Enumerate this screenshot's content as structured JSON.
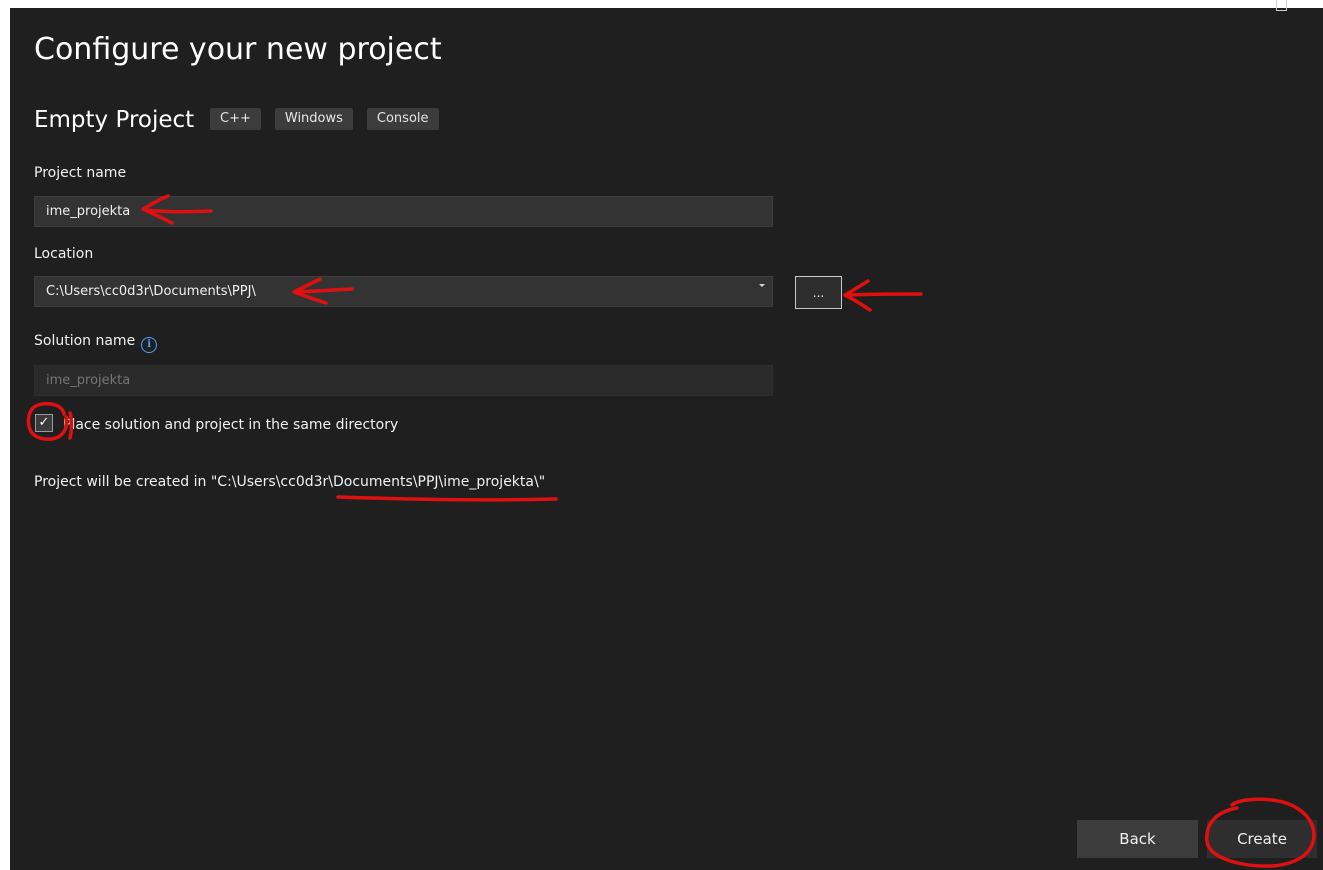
{
  "page": {
    "title": "Configure your new project",
    "template_name": "Empty Project",
    "tags": [
      "C++",
      "Windows",
      "Console"
    ]
  },
  "fields": {
    "project_name_label": "Project name",
    "project_name_value": "ime_projekta",
    "location_label": "Location",
    "location_value": "C:\\Users\\cc0d3r\\Documents\\PPJ\\",
    "browse_label": "...",
    "solution_name_label": "Solution name",
    "solution_name_placeholder": "ime_projekta",
    "info_glyph": "i"
  },
  "options": {
    "same_directory_checked": true,
    "check_glyph": "✓",
    "same_directory_label": "Place solution and project in the same directory"
  },
  "summary": {
    "created_path_text": "Project will be created in \"C:\\Users\\cc0d3r\\Documents\\PPJ\\ime_projekta\\\""
  },
  "footer": {
    "back_label": "Back",
    "create_label": "Create"
  },
  "colors": {
    "background": "#1f1f1f",
    "annotation": "#e01010",
    "info_accent": "#4aa3ff"
  },
  "icons": {
    "info": "info-icon",
    "checkmark": "checkmark-icon",
    "dropdown": "chevron-down-icon",
    "maximize": "maximize-icon"
  }
}
